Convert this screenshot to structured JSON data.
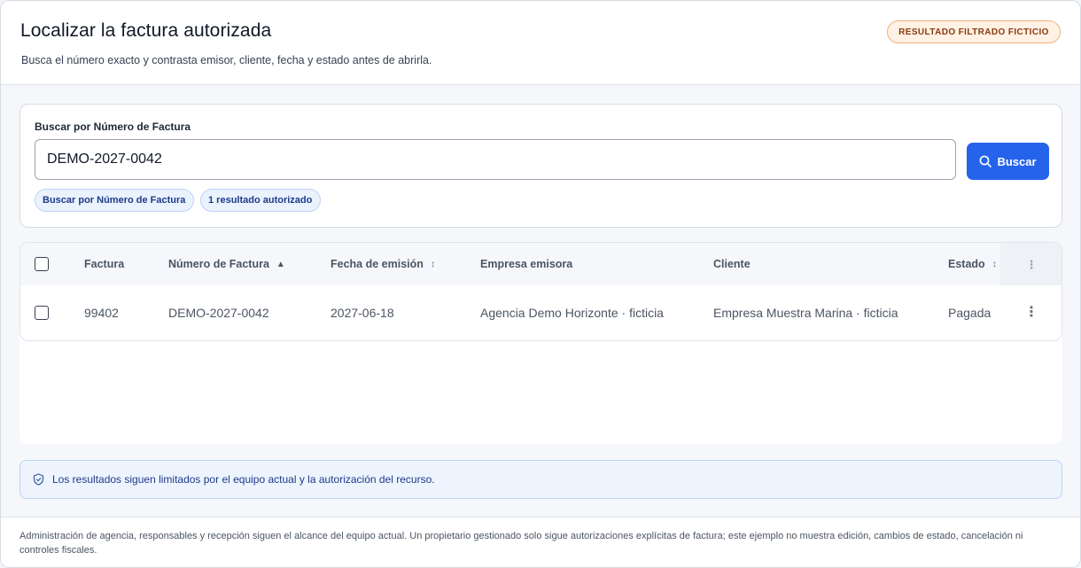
{
  "header": {
    "title": "Localizar la factura autorizada",
    "subtitle": "Busca el número exacto y contrasta emisor, cliente, fecha y estado antes de abrirla.",
    "badge": "RESULTADO FILTRADO FICTICIO"
  },
  "search": {
    "label": "Buscar por Número de Factura",
    "value": "DEMO-2027-0042",
    "button_label": "Buscar",
    "chips": [
      "Buscar por Número de Factura",
      "1 resultado autorizado"
    ]
  },
  "table": {
    "columns": {
      "factura": "Factura",
      "numero": "Número de Factura",
      "fecha": "Fecha de emisión",
      "emisora": "Empresa emisora",
      "cliente": "Cliente",
      "estado": "Estado"
    },
    "sort_icons": {
      "numero": "▲",
      "fecha": "↕",
      "estado": "↕"
    },
    "rows": [
      {
        "factura": "99402",
        "numero": "DEMO-2027-0042",
        "fecha": "2027-06-18",
        "emisora": "Agencia Demo Horizonte · ficticia",
        "cliente": "Empresa Muestra Marina · ficticia",
        "estado": "Pagada"
      }
    ]
  },
  "notice": "Los resultados siguen limitados por el equipo actual y la autorización del recurso.",
  "footer": "Administración de agencia, responsables y recepción siguen el alcance del equipo actual. Un propietario gestionado solo sigue autorizaciones explícitas de factura; este ejemplo no muestra edición, cambios de estado, cancelación ni controles fiscales.",
  "colors": {
    "accent": "#2563eb",
    "badge_bg": "#fff1e4",
    "badge_border": "#f4b27a",
    "chip_bg": "#eaf2fd",
    "notice_bg": "#edf4fd"
  },
  "icons": {
    "search_button": "search-icon",
    "notice": "shield-check-icon",
    "row_menu": "kebab-menu-icon",
    "column_menu": "kebab-menu-icon"
  }
}
